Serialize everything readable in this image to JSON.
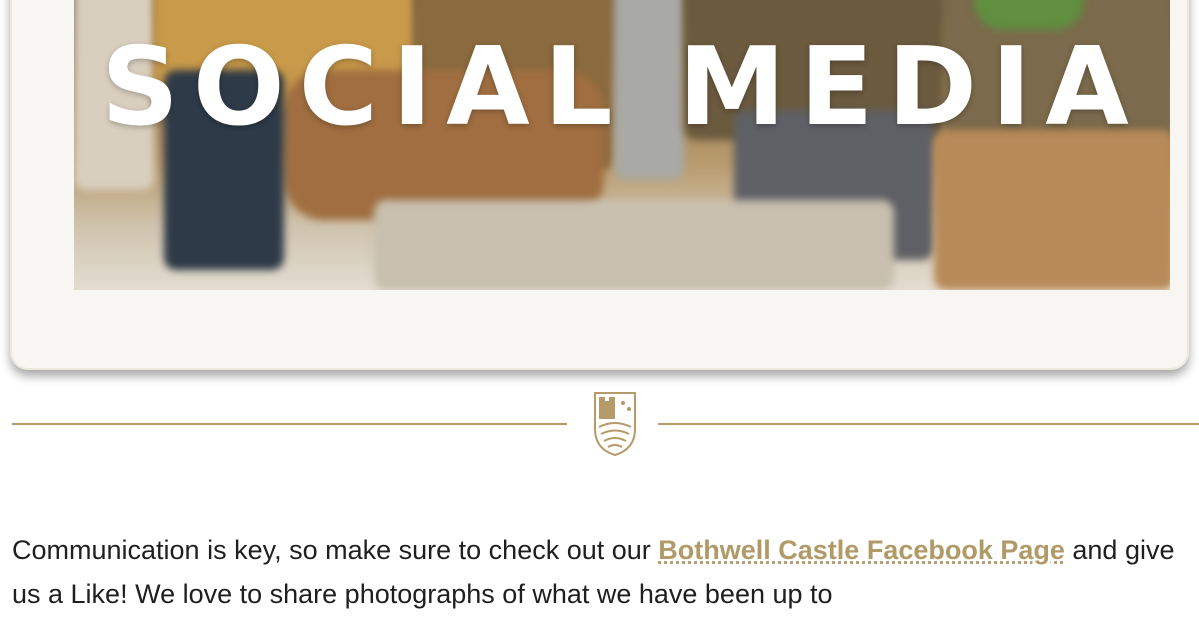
{
  "banner": {
    "title": "SOCIAL MEDIA",
    "image_icon": "lobby-photo"
  },
  "divider": {
    "icon": "castle-crest-icon",
    "color": "#b59a6a"
  },
  "intro": {
    "text_before": "Communication is key, so make sure to check out our ",
    "link_label": "Bothwell Castle Facebook Page",
    "text_after": " and give us a Like! We love to share photographs of what we have been up to",
    "link_color": "#b09a67"
  }
}
